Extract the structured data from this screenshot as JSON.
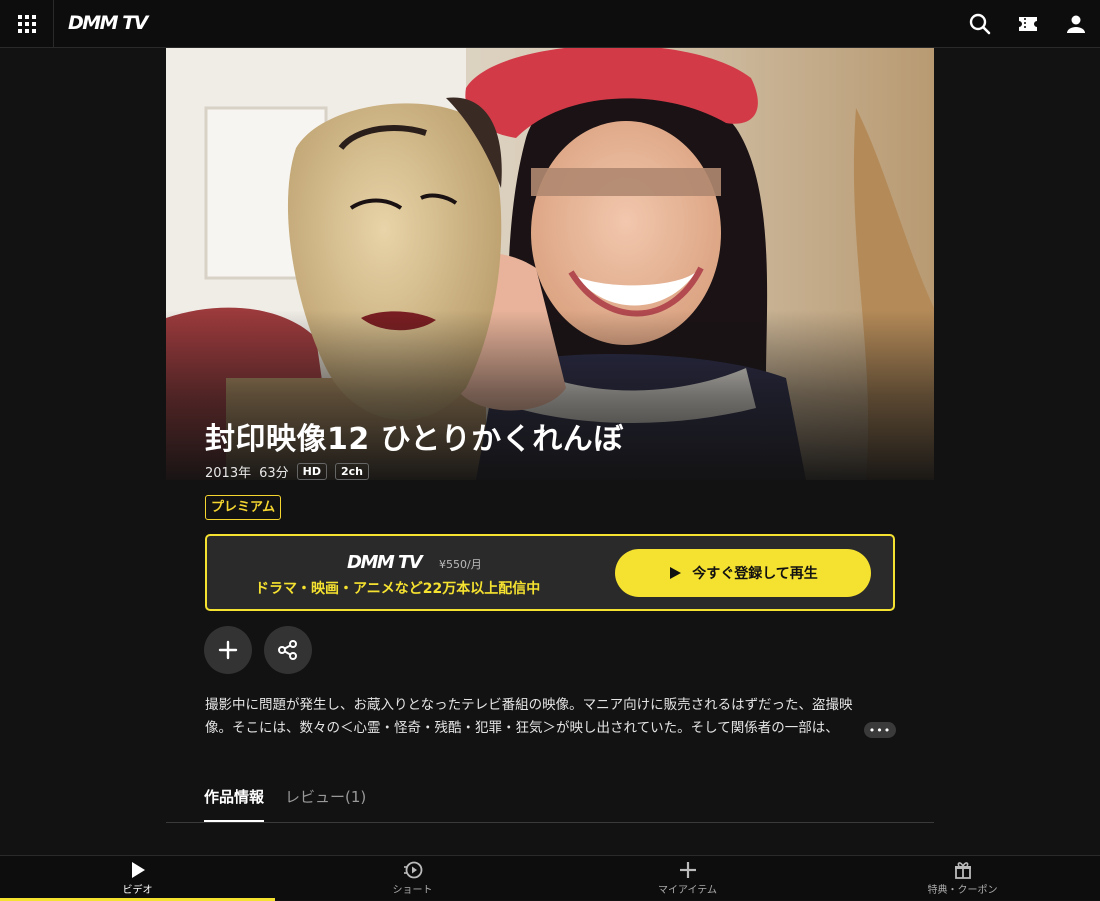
{
  "header": {
    "logo": "DMM TV",
    "icons": [
      "grid-menu-icon",
      "search-icon",
      "ticket-icon",
      "user-icon"
    ]
  },
  "hero": {
    "image": "video-thumbnail"
  },
  "title": {
    "text": "封印映像12 ひとりかくれんぼ",
    "year": "2013年",
    "duration": "63分",
    "tags": [
      "HD",
      "2ch"
    ],
    "badge": "プレミアム"
  },
  "subscribe": {
    "logo": "DMM TV",
    "price": "¥550/月",
    "catchcopy": "ドラマ・映画・アニメなど22万本以上配信中",
    "button_label": "今すぐ登録して再生"
  },
  "actions": {
    "icons": [
      "plus-icon",
      "share-icon"
    ]
  },
  "description": {
    "line1": "撮影中に問題が発生し、お蔵入りとなったテレビ番組の映像。マニア向けに販売されるはずだった、盗撮映",
    "line2": "像。そこには、数々の＜心霊・怪奇・残酷・犯罪・狂気＞が映し出されていた。そして関係者の一部は、",
    "more_label": "•••"
  },
  "tabs": [
    {
      "label": "作品情報",
      "active": true
    },
    {
      "label": "レビュー(1)",
      "active": false
    }
  ],
  "bottom_nav": [
    {
      "label": "ビデオ",
      "icon": "play-icon",
      "active": true
    },
    {
      "label": "ショート",
      "icon": "short-video-icon",
      "active": false
    },
    {
      "label": "マイアイテム",
      "icon": "plus-icon",
      "active": false
    },
    {
      "label": "特典・クーポン",
      "icon": "gift-icon",
      "active": false
    }
  ],
  "colors": {
    "accent": "#f5e130",
    "background": "#121212",
    "header": "#0d0d0d"
  }
}
